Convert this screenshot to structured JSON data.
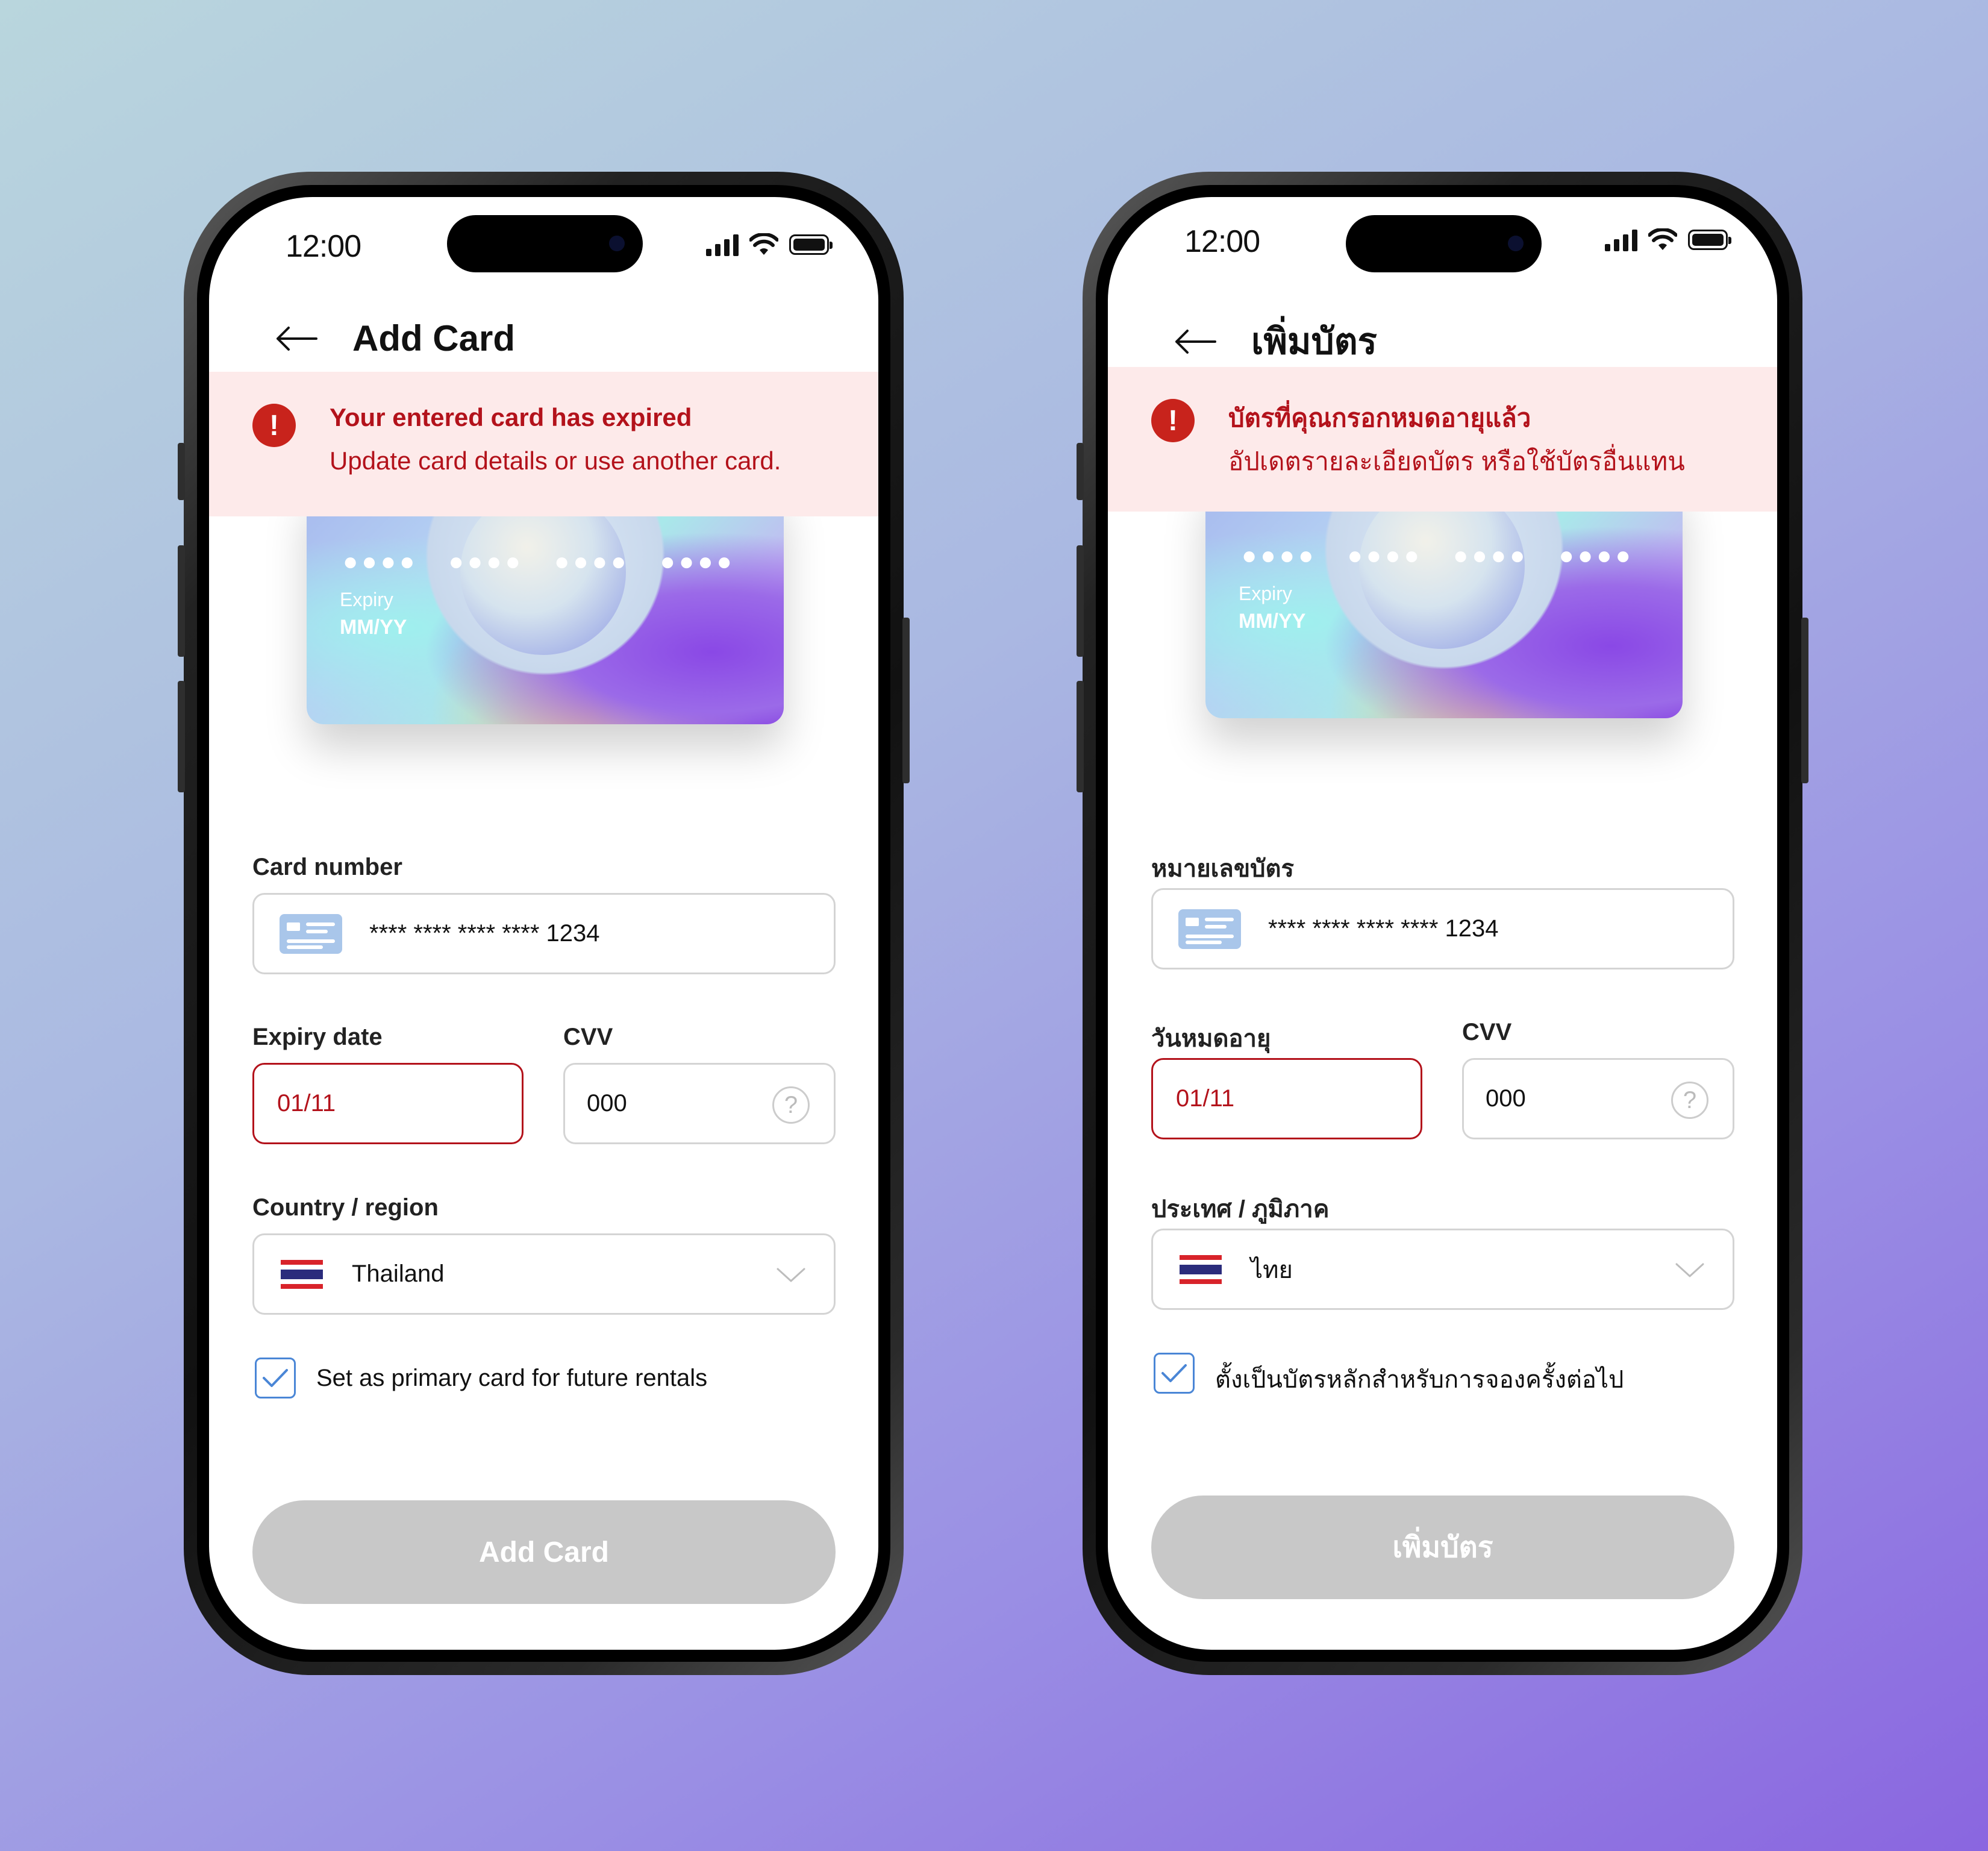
{
  "screens": [
    {
      "status": {
        "time": "12:00"
      },
      "header": {
        "title": "Add Card"
      },
      "alert": {
        "title": "Your entered card has expired",
        "description": "Update card details or use another card."
      },
      "card_preview": {
        "number_mask": [
          "●●●●",
          "●●●●",
          "●●●●",
          "●●●●"
        ],
        "expiry_label": "Expiry",
        "expiry_value": "MM/YY"
      },
      "form": {
        "card_number_label": "Card number",
        "card_number_value": "**** **** **** **** 1234",
        "expiry_label": "Expiry date",
        "expiry_value": "01/11",
        "cvv_label": "CVV",
        "cvv_value": "000",
        "cvv_help": "?",
        "country_label": "Country / region",
        "country_value": "Thailand",
        "primary_checkbox_label": "Set as primary card for future rentals",
        "primary_checked": true
      },
      "submit_label": "Add Card"
    },
    {
      "status": {
        "time": "12:00"
      },
      "header": {
        "title": "เพิ่มบัตร"
      },
      "alert": {
        "title": "บัตรที่คุณกรอกหมดอายุแล้ว",
        "description": "อัปเดตรายละเอียดบัตร หรือใช้บัตรอื่นแทน"
      },
      "card_preview": {
        "number_mask": [
          "●●●●",
          "●●●●",
          "●●●●",
          "●●●●"
        ],
        "expiry_label": "Expiry",
        "expiry_value": "MM/YY"
      },
      "form": {
        "card_number_label": "หมายเลขบัตร",
        "card_number_value": "**** **** **** **** 1234",
        "expiry_label": "วันหมดอายุ",
        "expiry_value": "01/11",
        "cvv_label": "CVV",
        "cvv_value": "000",
        "cvv_help": "?",
        "country_label": "ประเทศ / ภูมิภาค",
        "country_value": "ไทย",
        "primary_checkbox_label": "ตั้งเป็นบัตรหลักสำหรับการจองครั้งต่อไป",
        "primary_checked": true
      },
      "submit_label": "เพิ่มบัตร"
    }
  ],
  "colors": {
    "error": "#b3121b",
    "alert_bg": "#fdeaea",
    "button_disabled": "#c8c8c8",
    "checkbox_accent": "#4a86d6"
  },
  "icons": [
    "back-arrow-icon",
    "error-icon",
    "card-icon",
    "help-icon",
    "thailand-flag-icon",
    "chevron-down-icon",
    "checkmark-icon",
    "signal-icon",
    "wifi-icon",
    "battery-icon"
  ]
}
